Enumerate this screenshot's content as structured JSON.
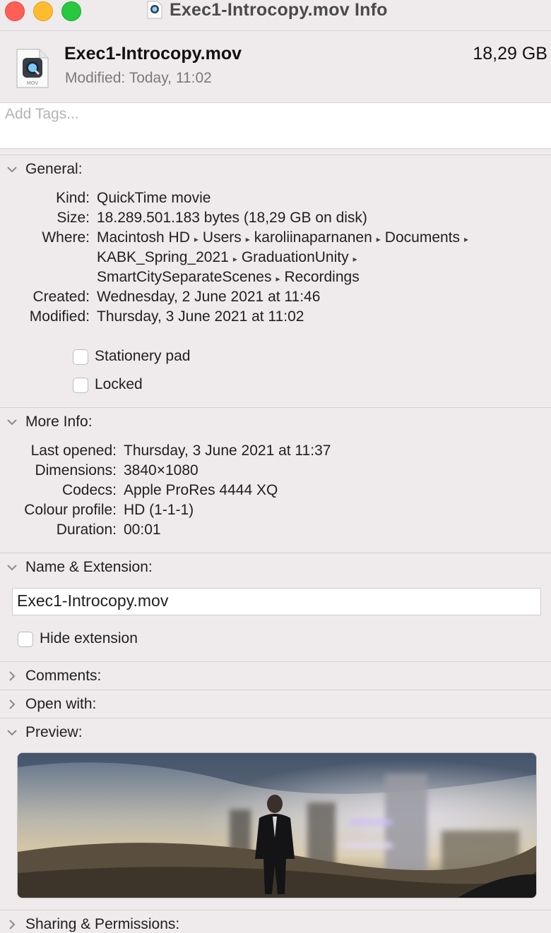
{
  "window": {
    "title": "Exec1-Introcopy.mov Info"
  },
  "header": {
    "file_name": "Exec1-Introcopy.mov",
    "file_size": "18,29 GB",
    "modified_label": "Modified:",
    "modified_value": "Today, 11:02",
    "icon_badge": "MOV"
  },
  "tags": {
    "placeholder": "Add Tags..."
  },
  "general": {
    "title": "General:",
    "kind_label": "Kind:",
    "kind_value": "QuickTime movie",
    "size_label": "Size:",
    "size_value": "18.289.501.183 bytes (18,29 GB on disk)",
    "where_label": "Where:",
    "where_path": [
      "Macintosh HD",
      "Users",
      "karoliinaparnanen",
      "Documents",
      "KABK_Spring_2021",
      "GraduationUnity",
      "SmartCitySeparateScenes",
      "Recordings"
    ],
    "created_label": "Created:",
    "created_value": "Wednesday, 2 June 2021 at 11:46",
    "modified_label": "Modified:",
    "modified_value": "Thursday, 3 June 2021 at 11:02",
    "stationery_label": "Stationery pad",
    "locked_label": "Locked"
  },
  "more_info": {
    "title": "More Info:",
    "last_opened_label": "Last opened:",
    "last_opened_value": "Thursday, 3 June 2021 at 11:37",
    "dimensions_label": "Dimensions:",
    "dimensions_value": "3840×1080",
    "codecs_label": "Codecs:",
    "codecs_value": "Apple ProRes 4444 XQ",
    "colour_profile_label": "Colour profile:",
    "colour_profile_value": "HD (1-1-1)",
    "duration_label": "Duration:",
    "duration_value": "00:01"
  },
  "name_extension": {
    "title": "Name & Extension:",
    "name_value": "Exec1-Introcopy.mov",
    "hide_extension_label": "Hide extension"
  },
  "comments": {
    "title": "Comments:"
  },
  "open_with": {
    "title": "Open with:"
  },
  "preview": {
    "title": "Preview:"
  },
  "sharing": {
    "title": "Sharing & Permissions:"
  },
  "icons": {
    "traffic_close": "close-icon",
    "traffic_minimize": "minimize-icon",
    "traffic_zoom": "zoom-icon",
    "file": "quicktime-file-icon",
    "expanded": "chevron-down-icon",
    "collapsed": "chevron-right-icon"
  },
  "colors": {
    "window_bg": "#efebec",
    "close": "#fe5f57",
    "minimize": "#febc2e",
    "zoom": "#28c840"
  }
}
